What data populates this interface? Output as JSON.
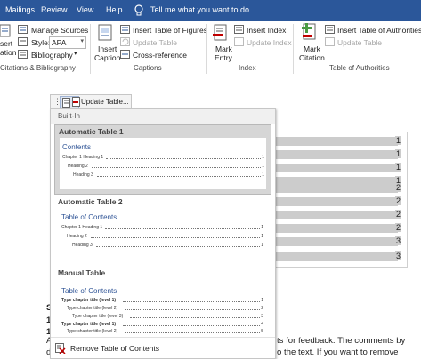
{
  "tabs": [
    "Mailings",
    "Review",
    "View",
    "Help"
  ],
  "tell_me": "Tell me what you want to do",
  "ribbon": {
    "citations": {
      "insert_citation": [
        "sert",
        "ation"
      ],
      "manage_sources": "Manage Sources",
      "style_label": "Style:",
      "style_value": "APA",
      "bibliography": "Bibliography",
      "group_label": "Citations & Bibliography"
    },
    "captions": {
      "insert_caption": [
        "Insert",
        "Caption"
      ],
      "insert_table_of_figures": "Insert Table of Figures",
      "update_table": "Update Table",
      "cross_reference": "Cross-reference",
      "group_label": "Captions"
    },
    "index": {
      "mark_entry": [
        "Mark",
        "Entry"
      ],
      "insert_index": "Insert Index",
      "update_index": "Update Index",
      "group_label": "Index"
    },
    "authorities": {
      "mark_citation": [
        "Mark",
        "Citation"
      ],
      "insert_table_of_authorities": "Insert Table of Authorities",
      "update_table": "Update Table",
      "group_label": "Table of Authorities"
    }
  },
  "field_toolbar": {
    "update_table": "Update Table..."
  },
  "dropdown": {
    "section_header": "Built-In",
    "gallery": [
      {
        "title": "Automatic Table 1",
        "heading": "Contents",
        "rows": [
          {
            "text": "Chapter 1 Heading 1",
            "num": "1",
            "level": 1
          },
          {
            "text": "Heading 2",
            "num": "1",
            "level": 2
          },
          {
            "text": "Heading 3",
            "num": "1",
            "level": 3
          }
        ]
      },
      {
        "title": "Automatic Table 2",
        "heading": "Table of Contents",
        "rows": [
          {
            "text": "Chapter 1 Heading 1",
            "num": "1",
            "level": 1
          },
          {
            "text": "Heading 2",
            "num": "1",
            "level": 2
          },
          {
            "text": "Heading 3",
            "num": "1",
            "level": 3
          }
        ]
      },
      {
        "title": "Manual Table",
        "heading": "Table of Contents",
        "rows": [
          {
            "text": "Type chapter title (level 1)",
            "num": "1",
            "level": 1
          },
          {
            "text": "Type chapter title (level 2)",
            "num": "2",
            "level": 2
          },
          {
            "text": "Type chapter title (level 3)",
            "num": "3",
            "level": 3
          },
          {
            "text": "Type chapter title (level 1)",
            "num": "4",
            "level": 1
          },
          {
            "text": "Type chapter title (level 2)",
            "num": "5",
            "level": 2
          }
        ]
      }
    ],
    "remove": "Remove Table of Contents"
  },
  "document": {
    "toc_page_numbers": [
      "1",
      "1",
      "1",
      "1",
      "2",
      "2",
      "2",
      "2",
      "3",
      "3"
    ],
    "body_fragments": {
      "line1": "ts for feedback. The comments by",
      "line2": "o the text. If you want to remove",
      "left_letters": [
        "S",
        "1",
        "1",
        "A",
        "d"
      ]
    }
  }
}
